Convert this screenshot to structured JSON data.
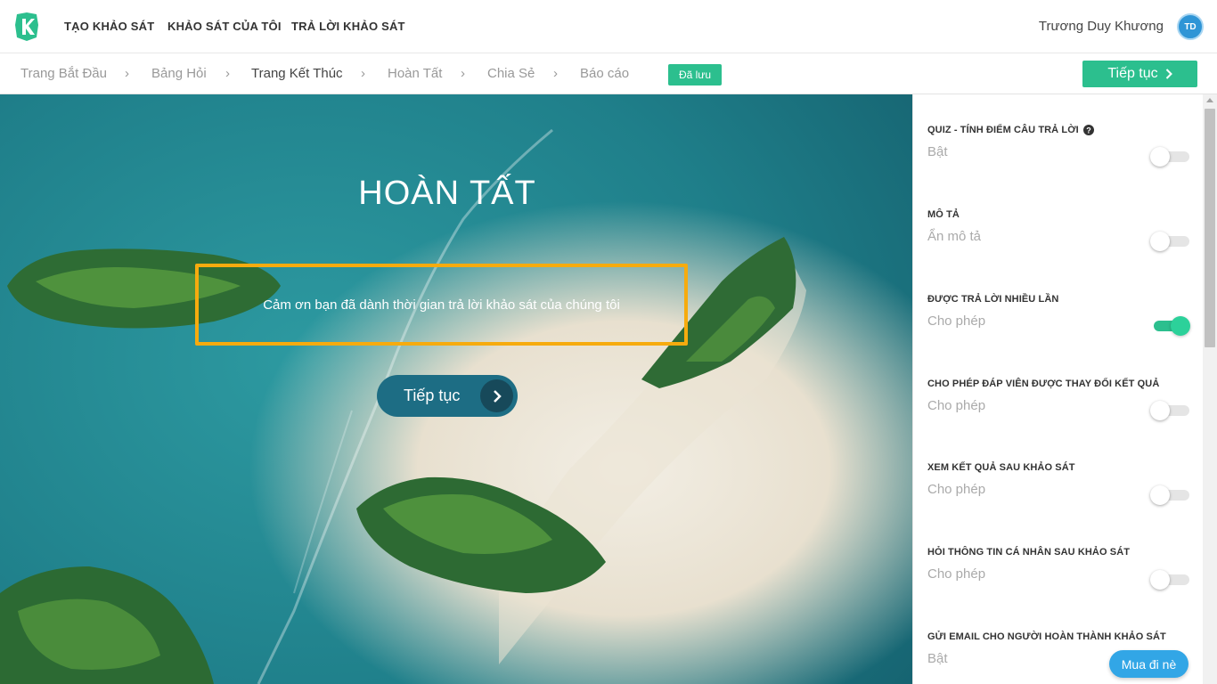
{
  "nav": {
    "links": [
      "TẠO KHẢO SÁT",
      "KHẢO SÁT CỦA TÔI",
      "TRẢ LỜI KHẢO SÁT"
    ],
    "user_name": "Trương Duy Khương",
    "avatar_initials": "TD"
  },
  "steps": {
    "items": [
      "Trang Bắt Đầu",
      "Bảng Hỏi",
      "Trang Kết Thúc",
      "Hoàn Tất",
      "Chia Sẻ",
      "Báo cáo"
    ],
    "active": "Trang Kết Thúc",
    "chevron": "›",
    "saved_badge": "Đã lưu",
    "continue_label": "Tiếp tục"
  },
  "hero": {
    "title": "HOÀN TẤT",
    "message": "Cảm ơn bạn đã dành thời gian trả lời khảo sát của chúng tôi",
    "button_label": "Tiếp tục"
  },
  "settings": [
    {
      "title": "QUIZ - TÍNH ĐIỂM CÂU TRẢ LỜI",
      "sub": "Bật",
      "on": false,
      "help": true
    },
    {
      "title": "MÔ TẢ",
      "sub": "Ẩn mô tả",
      "on": false
    },
    {
      "title": "ĐƯỢC TRẢ LỜI NHIỀU LẦN",
      "sub": "Cho phép",
      "on": true
    },
    {
      "title": "CHO PHÉP ĐÁP VIÊN ĐƯỢC THAY ĐỔI KẾT QUẢ",
      "sub": "Cho phép",
      "on": false
    },
    {
      "title": "XEM KẾT QUẢ SAU KHẢO SÁT",
      "sub": "Cho phép",
      "on": false
    },
    {
      "title": "HỎI THÔNG TIN CÁ NHÂN SAU KHẢO SÁT",
      "sub": "Cho phép",
      "on": false
    },
    {
      "title": "GỬI EMAIL CHO NGƯỜI HOÀN THÀNH KHẢO SÁT",
      "sub": "Bật",
      "on": false
    }
  ],
  "buy_button": "Mua đi nè",
  "colors": {
    "brand": "#2cbf8e",
    "highlight_border": "#f6ab0e",
    "buy": "#32a6e6"
  }
}
